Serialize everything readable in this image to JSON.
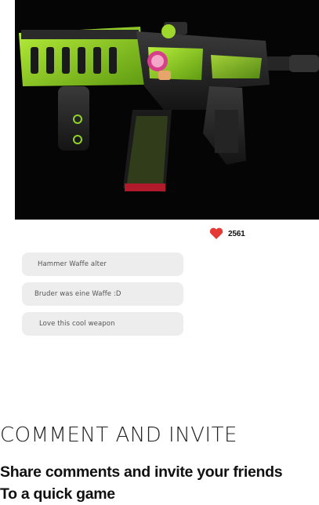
{
  "likes": {
    "count": "2561"
  },
  "comments": [
    {
      "text": "Hammer Waffe alter"
    },
    {
      "text": "Bruder was eine Waffe :D"
    },
    {
      "text": "Love this cool weapon"
    }
  ],
  "section": {
    "title": "COMMENT AND INVITE",
    "subtitle_line1": "Share comments and invite your friends",
    "subtitle_line2": "To a quick game"
  },
  "colors": {
    "accent": "#8fd22a",
    "heart": "#e53935"
  },
  "icons": {
    "like": "heart-icon"
  }
}
